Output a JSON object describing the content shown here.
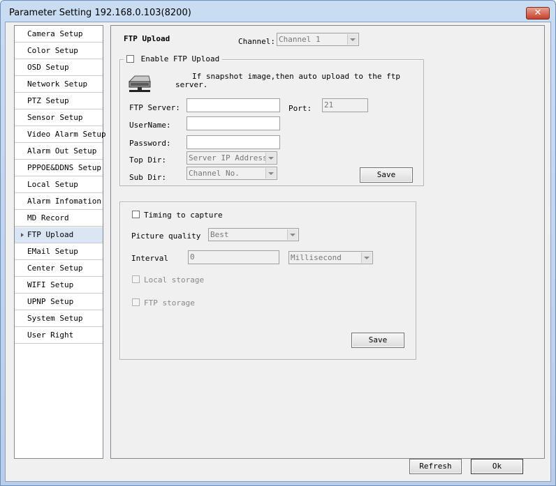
{
  "window": {
    "title": "Parameter Setting 192.168.0.103(8200)",
    "close_label": "✕"
  },
  "sidebar": {
    "items": [
      {
        "label": "Camera Setup"
      },
      {
        "label": "Color Setup"
      },
      {
        "label": "OSD Setup"
      },
      {
        "label": "Network Setup"
      },
      {
        "label": "PTZ Setup"
      },
      {
        "label": "Sensor Setup"
      },
      {
        "label": "Video Alarm Setup"
      },
      {
        "label": "Alarm Out Setup"
      },
      {
        "label": "PPPOE&DDNS Setup"
      },
      {
        "label": "Local Setup"
      },
      {
        "label": "Alarm Infomation"
      },
      {
        "label": "MD Record"
      },
      {
        "label": "FTP Upload",
        "selected": true
      },
      {
        "label": "EMail Setup"
      },
      {
        "label": "Center Setup"
      },
      {
        "label": "WIFI Setup"
      },
      {
        "label": "UPNP Setup"
      },
      {
        "label": "System Setup"
      },
      {
        "label": "User Right"
      }
    ]
  },
  "panel": {
    "title": "FTP Upload",
    "channel_label": "Channel:",
    "channel_value": "Channel 1"
  },
  "ftp_group": {
    "enable_label": "Enable FTP Upload",
    "enable_checked": false,
    "info_line1": "If snapshot image,then auto upload to the ftp",
    "info_line2": "server.",
    "server_label": "FTP Server:",
    "server_value": "",
    "port_label": "Port:",
    "port_value": "21",
    "username_label": "UserName:",
    "username_value": "",
    "password_label": "Password:",
    "password_value": "",
    "topdir_label": "Top Dir:",
    "topdir_value": "Server IP Address",
    "subdir_label": "Sub Dir:",
    "subdir_value": "Channel No.",
    "save_label": "Save"
  },
  "timing_group": {
    "timing_label": "Timing to capture",
    "timing_checked": false,
    "quality_label": "Picture quality",
    "quality_value": "Best",
    "interval_label": "Interval",
    "interval_value": "0",
    "interval_unit": "Millisecond",
    "local_storage_label": "Local storage",
    "ftp_storage_label": "FTP storage",
    "save_label": "Save"
  },
  "footer": {
    "refresh_label": "Refresh",
    "ok_label": "Ok"
  },
  "icons": {
    "ftp": "hard-drive-upload-icon",
    "arrow": "selected-arrow-icon"
  }
}
